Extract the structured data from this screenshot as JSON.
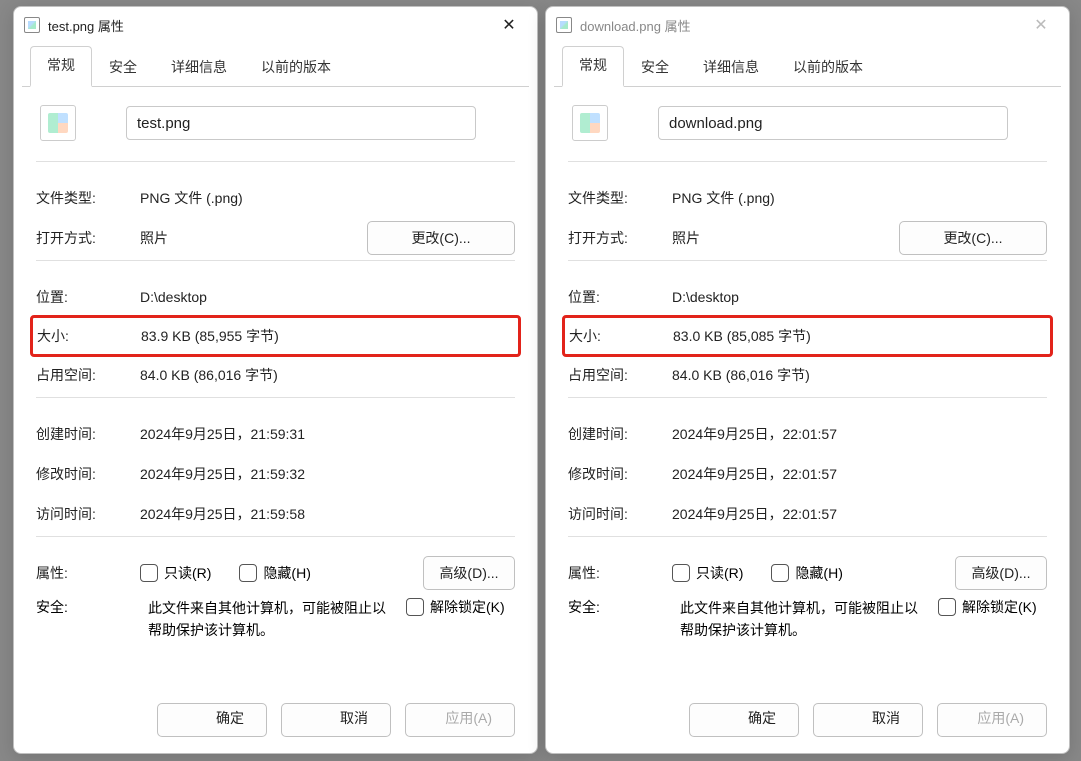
{
  "dialogs": [
    {
      "title": "test.png 属性",
      "active": true,
      "tabs": [
        "常规",
        "安全",
        "详细信息",
        "以前的版本"
      ],
      "filename": "test.png",
      "filetype_label": "文件类型:",
      "filetype": "PNG 文件 (.png)",
      "openwith_label": "打开方式:",
      "openwith": "照片",
      "change_btn": "更改(C)...",
      "location_label": "位置:",
      "location": "D:\\desktop",
      "size_label": "大小:",
      "size": "83.9 KB (85,955 字节)",
      "sizeondisk_label": "占用空间:",
      "sizeondisk": "84.0 KB (86,016 字节)",
      "created_label": "创建时间:",
      "created": "2024年9月25日，21:59:31",
      "modified_label": "修改时间:",
      "modified": "2024年9月25日，21:59:32",
      "accessed_label": "访问时间:",
      "accessed": "2024年9月25日，21:59:58",
      "attrs_label": "属性:",
      "readonly": "只读(R)",
      "hidden": "隐藏(H)",
      "advanced_btn": "高级(D)...",
      "security_label": "安全:",
      "security_text": "此文件来自其他计算机，可能被阻止以帮助保护该计算机。",
      "unblock": "解除锁定(K)",
      "ok": "确定",
      "cancel": "取消",
      "apply": "应用(A)"
    },
    {
      "title": "download.png 属性",
      "active": false,
      "tabs": [
        "常规",
        "安全",
        "详细信息",
        "以前的版本"
      ],
      "filename": "download.png",
      "filetype_label": "文件类型:",
      "filetype": "PNG 文件 (.png)",
      "openwith_label": "打开方式:",
      "openwith": "照片",
      "change_btn": "更改(C)...",
      "location_label": "位置:",
      "location": "D:\\desktop",
      "size_label": "大小:",
      "size": "83.0 KB (85,085 字节)",
      "sizeondisk_label": "占用空间:",
      "sizeondisk": "84.0 KB (86,016 字节)",
      "created_label": "创建时间:",
      "created": "2024年9月25日，22:01:57",
      "modified_label": "修改时间:",
      "modified": "2024年9月25日，22:01:57",
      "accessed_label": "访问时间:",
      "accessed": "2024年9月25日，22:01:57",
      "attrs_label": "属性:",
      "readonly": "只读(R)",
      "hidden": "隐藏(H)",
      "advanced_btn": "高级(D)...",
      "security_label": "安全:",
      "security_text": "此文件来自其他计算机，可能被阻止以帮助保护该计算机。",
      "unblock": "解除锁定(K)",
      "ok": "确定",
      "cancel": "取消",
      "apply": "应用(A)"
    }
  ]
}
